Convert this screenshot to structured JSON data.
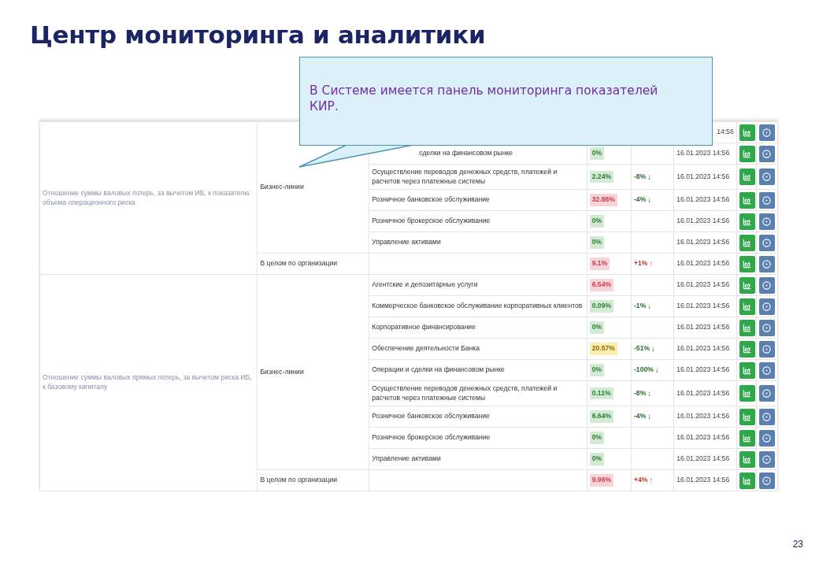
{
  "title": "Центр мониторинга и аналитики",
  "callout": {
    "text": "В Системе имеется панель мониторинга показателей КИР."
  },
  "table": {
    "groups": [
      {
        "indicator": "Отношение суммы валовых потерь, за вычетом ИБ, к показателю объема операционного риска",
        "section": "Бизнес-линии",
        "lines": [
          {
            "date": "14:56"
          },
          {
            "name": "сделки на финансовом рынке",
            "value": "0%",
            "color": "#d3ebd5",
            "date": "16.01.2023 14:56"
          },
          {
            "name": "Осуществление переводов денежных средств, платежей и расчетов через платежные системы",
            "value": "2.24%",
            "color": "#d3ebd5",
            "trend": {
              "text": "-8%",
              "arrow": "↓",
              "color": "#2e6b2e"
            },
            "date": "16.01.2023 14:56"
          },
          {
            "name": "Розничное банковское обслуживание",
            "value": "32.86%",
            "color": "#f8d4d8",
            "trend": {
              "text": "-4%",
              "arrow": "↓",
              "color": "#2e6b2e"
            },
            "date": "16.01.2023 14:56"
          },
          {
            "name": "Розничное брокерское обслуживание",
            "value": "0%",
            "color": "#d3ebd5",
            "date": "16.01.2023 14:56"
          },
          {
            "name": "Управление активами",
            "value": "0%",
            "color": "#d3ebd5",
            "date": "16.01.2023 14:56"
          }
        ],
        "total": {
          "label": "В целом по организации",
          "value": "9.1%",
          "color": "#f8d4d8",
          "trend": {
            "text": "+1%",
            "arrow": "↑",
            "color": "#c0392b"
          },
          "date": "16.01.2023 14:56"
        }
      },
      {
        "indicator": "Отношение суммы валовых прямых потерь, за вычетом риска ИБ, к базовому капиталу",
        "section": "Бизнес-линии",
        "lines": [
          {
            "name": "Агентские и депозитарные услуги",
            "value": "6.54%",
            "color": "#f8d4d8",
            "date": "16.01.2023 14:56"
          },
          {
            "name": "Коммерческое банковское обслуживание корпоративных клиентов",
            "value": "0.09%",
            "color": "#d3ebd5",
            "trend": {
              "text": "-1%",
              "arrow": "↓",
              "color": "#2e6b2e"
            },
            "date": "16.01.2023 14:56"
          },
          {
            "name": "Корпоративное финансирование",
            "value": "0%",
            "color": "#d3ebd5",
            "date": "16.01.2023 14:56"
          },
          {
            "name": "Обеспечение деятельности Банка",
            "value": "20.57%",
            "color": "#fbeeb0",
            "trend": {
              "text": "-51%",
              "arrow": "↓",
              "color": "#2e6b2e"
            },
            "date": "16.01.2023 14:56"
          },
          {
            "name": "Операции и сделки на финансовом рынке",
            "value": "0%",
            "color": "#d3ebd5",
            "trend": {
              "text": "-100%",
              "arrow": "↓",
              "color": "#2e6b2e"
            },
            "date": "16.01.2023 14:56"
          },
          {
            "name": "Осуществление переводов денежных средств, платежей и расчетов через платежные системы",
            "value": "0.11%",
            "color": "#d3ebd5",
            "trend": {
              "text": "-8%",
              "arrow": "↓",
              "color": "#2e6b2e"
            },
            "date": "16.01.2023 14:56"
          },
          {
            "name": "Розничное банковское обслуживание",
            "value": "6.64%",
            "color": "#d3ebd5",
            "trend": {
              "text": "-4%",
              "arrow": "↓",
              "color": "#2e6b2e"
            },
            "date": "16.01.2023 14:56"
          },
          {
            "name": "Розничное брокерское обслуживание",
            "value": "0%",
            "color": "#d3ebd5",
            "date": "16.01.2023 14:56"
          },
          {
            "name": "Управление активами",
            "value": "0%",
            "color": "#d3ebd5",
            "date": "16.01.2023 14:56"
          }
        ],
        "total": {
          "label": "В целом по организации",
          "value": "9.96%",
          "color": "#f8d4d8",
          "trend": {
            "text": "+4%",
            "arrow": "↑",
            "color": "#c0392b"
          },
          "date": "16.01.2023 14:56"
        }
      }
    ]
  },
  "page_number": "23"
}
